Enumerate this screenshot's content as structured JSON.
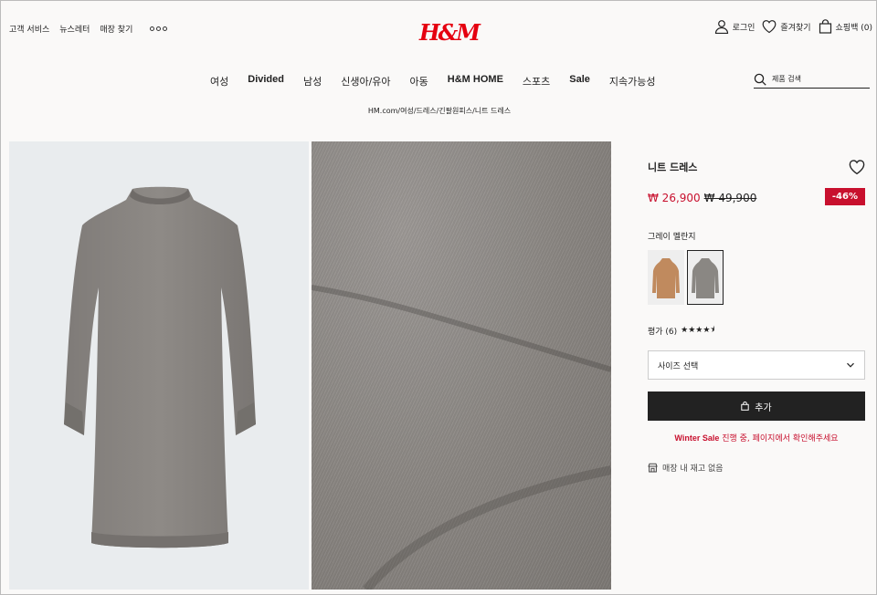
{
  "header": {
    "util_left": [
      "고객 서비스",
      "뉴스레터",
      "매장 찾기"
    ],
    "logo": "H&M",
    "login": "로그인",
    "favorites": "즐겨찾기",
    "cart": "쇼핑백 (0)"
  },
  "nav": {
    "items": [
      "여성",
      "Divided",
      "남성",
      "신생아/유아",
      "아동",
      "H&M HOME",
      "스포츠",
      "Sale",
      "지속가능성"
    ],
    "search_placeholder": "제품 검색"
  },
  "breadcrumb": "HM.com/여성/드레스/긴팔원피스/니트 드레스",
  "product": {
    "title": "니트 드레스",
    "price_sale": "₩ 26,900",
    "price_original": "₩ 49,900",
    "discount": "-46%",
    "color_name": "그레이 멜란지",
    "swatches": [
      {
        "color": "#c08a5e",
        "selected": false
      },
      {
        "color": "#8a8783",
        "selected": true
      }
    ],
    "rating_label": "평가 (6)",
    "rating_value": 4.5,
    "size_placeholder": "사이즈 선택",
    "add_button": "추가",
    "promo_brand": "Winter Sale",
    "promo_text": " 진행 중, 페이지에서 확인해주세요",
    "store_text": "매장 내 재고 없음"
  }
}
